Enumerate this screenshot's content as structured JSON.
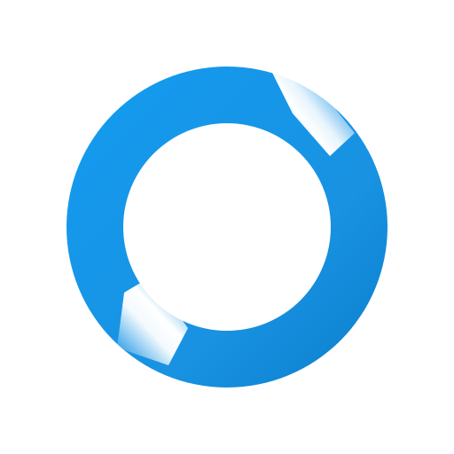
{
  "logo": {
    "shape": "ring",
    "colors": {
      "blue_light": "#07A4F8",
      "blue_mid": "#1992E2",
      "blue_dark": "#0074BE",
      "highlight": "#FFFFFF",
      "background": "#FFFFFF"
    }
  }
}
